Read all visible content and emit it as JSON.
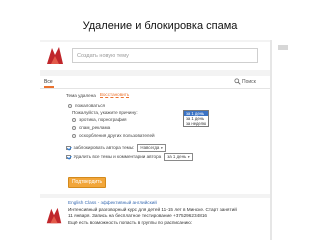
{
  "slide": {
    "title": "Удаление и блокировка спама"
  },
  "composer": {
    "placeholder": "Создать новую тему"
  },
  "tabs": {
    "all": "Все",
    "search": "Поиск"
  },
  "form": {
    "topic_label": "Тема удалена",
    "restore_link": "Восстановить",
    "complain": "пожаловаться",
    "reason_hint": "Пожалуйста, укажите причину:",
    "reasons": [
      "эротика, порнография",
      "спам_реклама",
      "оскорбления других пользователей"
    ],
    "block_label": "заблокировать автора темы:",
    "block_duration": "Навсегда",
    "delete_label": "Удалить все темы и комментарии автора",
    "delete_period": "за 1 день",
    "period_options": [
      "за 1 день",
      "за 1 день",
      "за неделю"
    ],
    "submit": "Подтвердить"
  },
  "post": {
    "group": "English Class - эффективный английский",
    "lines": [
      "Интенсивный разговорный курс для детей 11-15 лет в Минске. Старт занятий",
      "11 января. Запись на бесплатное тестирование +375296234816",
      "Ещё есть возможность попасть в группы по расписанию:"
    ]
  },
  "colors": {
    "accent": "#eb722e",
    "button": "#f2a63a",
    "link": "#3b6db3"
  }
}
